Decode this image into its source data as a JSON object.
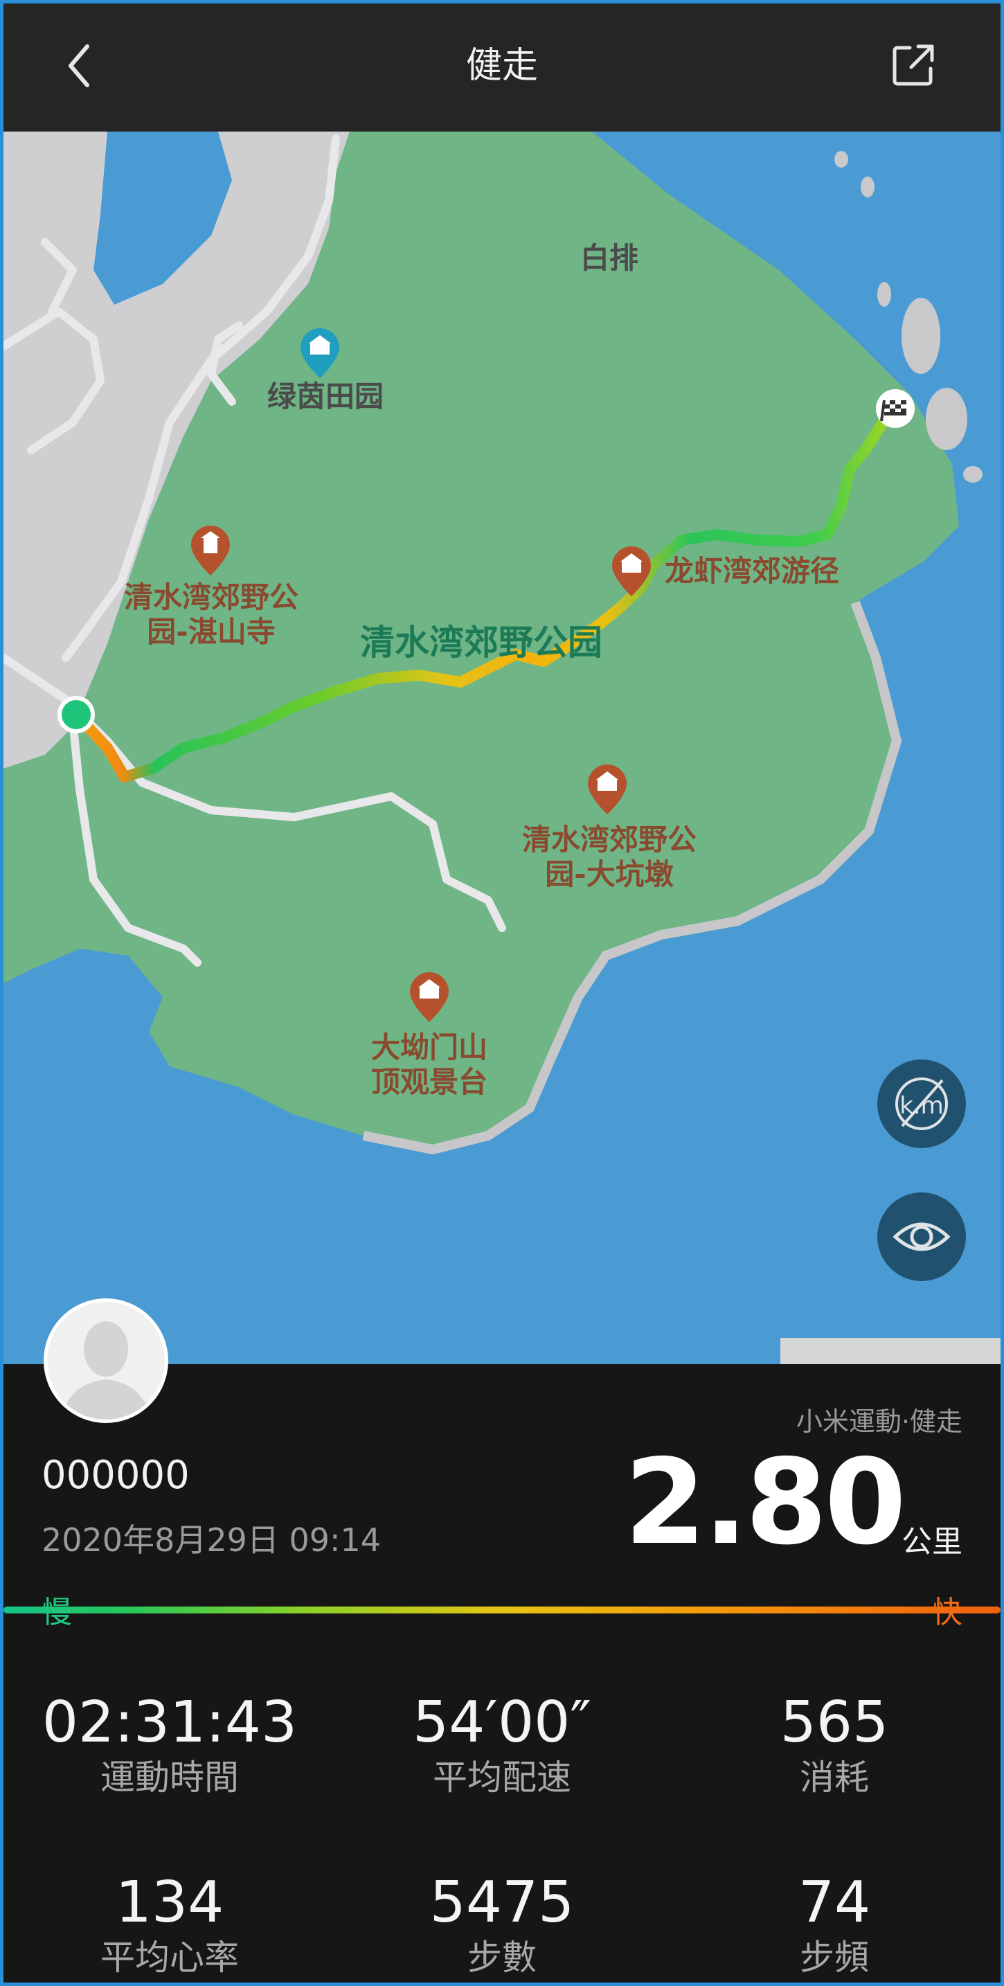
{
  "header": {
    "title": "健走",
    "back_icon": "back-chevron-icon",
    "share_icon": "share-icon"
  },
  "map": {
    "labels": {
      "baipai": "白排",
      "lvyin": "绿茵田园",
      "zhanshan": "清水湾郊野公\n园-湛山寺",
      "longxia": "龙虾湾郊游径",
      "park": "清水湾郊野公园",
      "dakeng": "清水湾郊野公\n园-大坑墩",
      "daao": "大坳门山\n顶观景台"
    },
    "colors": {
      "sea": "#4a9bd3",
      "park": "#6fb586",
      "urban": "#cfcfd1"
    }
  },
  "summary": {
    "source": "小米運動·健走",
    "user": "000000",
    "datetime": "2020年8月29日 09:14",
    "distance": "2.80",
    "distance_unit": "公里",
    "pace_slow": "慢",
    "pace_fast": "快"
  },
  "stats": [
    {
      "value": "02:31:43",
      "label": "運動時間"
    },
    {
      "value": "54′00″",
      "label": "平均配速"
    },
    {
      "value": "565",
      "label": "消耗"
    },
    {
      "value": "134",
      "label": "平均心率"
    },
    {
      "value": "5475",
      "label": "步數"
    },
    {
      "value": "74",
      "label": "步頻"
    }
  ]
}
